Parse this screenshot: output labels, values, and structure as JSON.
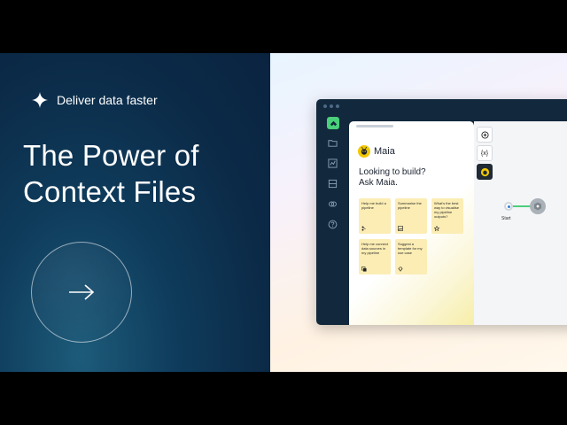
{
  "promo": {
    "tagline": "Deliver data faster",
    "headline_line1": "The Power of",
    "headline_line2": "Context Files",
    "arrow_symbol": "→"
  },
  "app": {
    "assistant_name": "Maia",
    "heading_line1": "Looking to build?",
    "heading_line2": "Ask Maia.",
    "cards": [
      {
        "label": "Help me build a pipeline",
        "icon": "pipeline-icon"
      },
      {
        "label": "Summarise the pipeline",
        "icon": "image-icon"
      },
      {
        "label": "What's the best way to visualise my pipeline outputs?",
        "icon": "star-icon"
      },
      {
        "label": "Help me connect data sources in my pipeline",
        "icon": "copy-icon"
      },
      {
        "label": "Suggest a template for my use case",
        "icon": "bulb-icon"
      }
    ],
    "toolbar": {
      "variables_label": "{x}"
    },
    "canvas": {
      "start_label": "Start"
    }
  },
  "colors": {
    "left_bg": "#0b2a47",
    "brand_green": "#4ad07a",
    "card_yellow": "#fbedb4",
    "maia_yellow": "#f3c800"
  }
}
